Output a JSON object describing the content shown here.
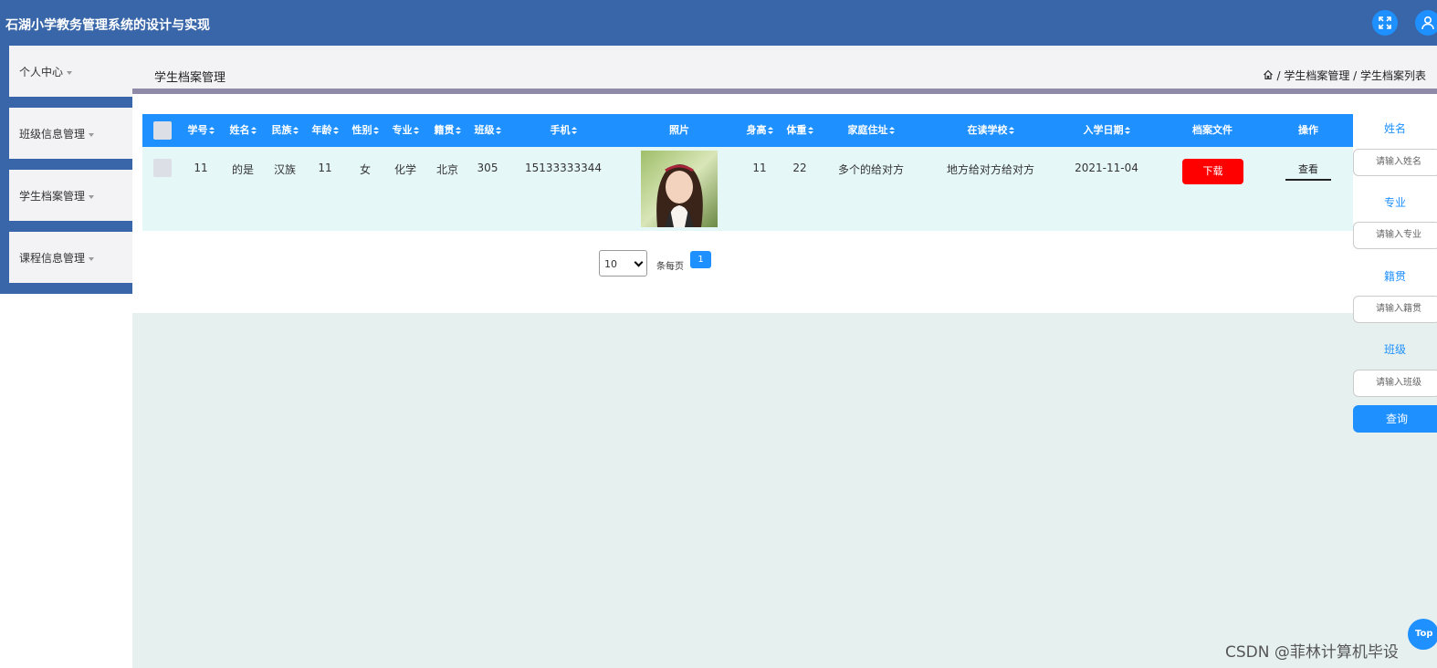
{
  "app": {
    "title": "石湖小学教务管理系统的设计与实现"
  },
  "sidebar": {
    "items": [
      {
        "label": "个人中心"
      },
      {
        "label": "班级信息管理"
      },
      {
        "label": "学生档案管理"
      },
      {
        "label": "课程信息管理"
      }
    ]
  },
  "header": {
    "page_title": "学生档案管理",
    "breadcrumb": "/ 学生档案管理 / 学生档案列表"
  },
  "table": {
    "headers": {
      "id": "学号",
      "name": "姓名",
      "ethnicity": "民族",
      "age": "年龄",
      "gender": "性别",
      "major": "专业",
      "origin": "籍贯",
      "class": "班级",
      "phone": "手机",
      "photo": "照片",
      "height": "身高",
      "weight": "体重",
      "address": "家庭住址",
      "school": "在读学校",
      "enroll_date": "入学日期",
      "file": "档案文件",
      "actions": "操作"
    },
    "rows": [
      {
        "id": "11",
        "name": "的是",
        "ethnicity": "汉族",
        "age": "11",
        "gender": "女",
        "major": "化学",
        "origin": "北京",
        "class": "305",
        "phone": "15133333344",
        "height": "11",
        "weight": "22",
        "address": "多个的给对方",
        "school": "地方给对方给对方",
        "enroll_date": "2021-11-04",
        "download_label": "下载",
        "view_label": "查看"
      }
    ]
  },
  "pagination": {
    "page_size": "10",
    "per_page_label": "条每页",
    "current_page": "1"
  },
  "search": {
    "name_label": "姓名",
    "name_placeholder": "请输入姓名",
    "major_label": "专业",
    "major_placeholder": "请输入专业",
    "origin_label": "籍贯",
    "origin_placeholder": "请输入籍贯",
    "class_label": "班级",
    "class_placeholder": "请输入班级",
    "button_label": "查询"
  },
  "top_button": "Top",
  "watermark": "CSDN @菲林计算机毕设",
  "colors": {
    "primary": "#1e90ff",
    "header": "#3866a8",
    "danger": "#ff0000"
  }
}
